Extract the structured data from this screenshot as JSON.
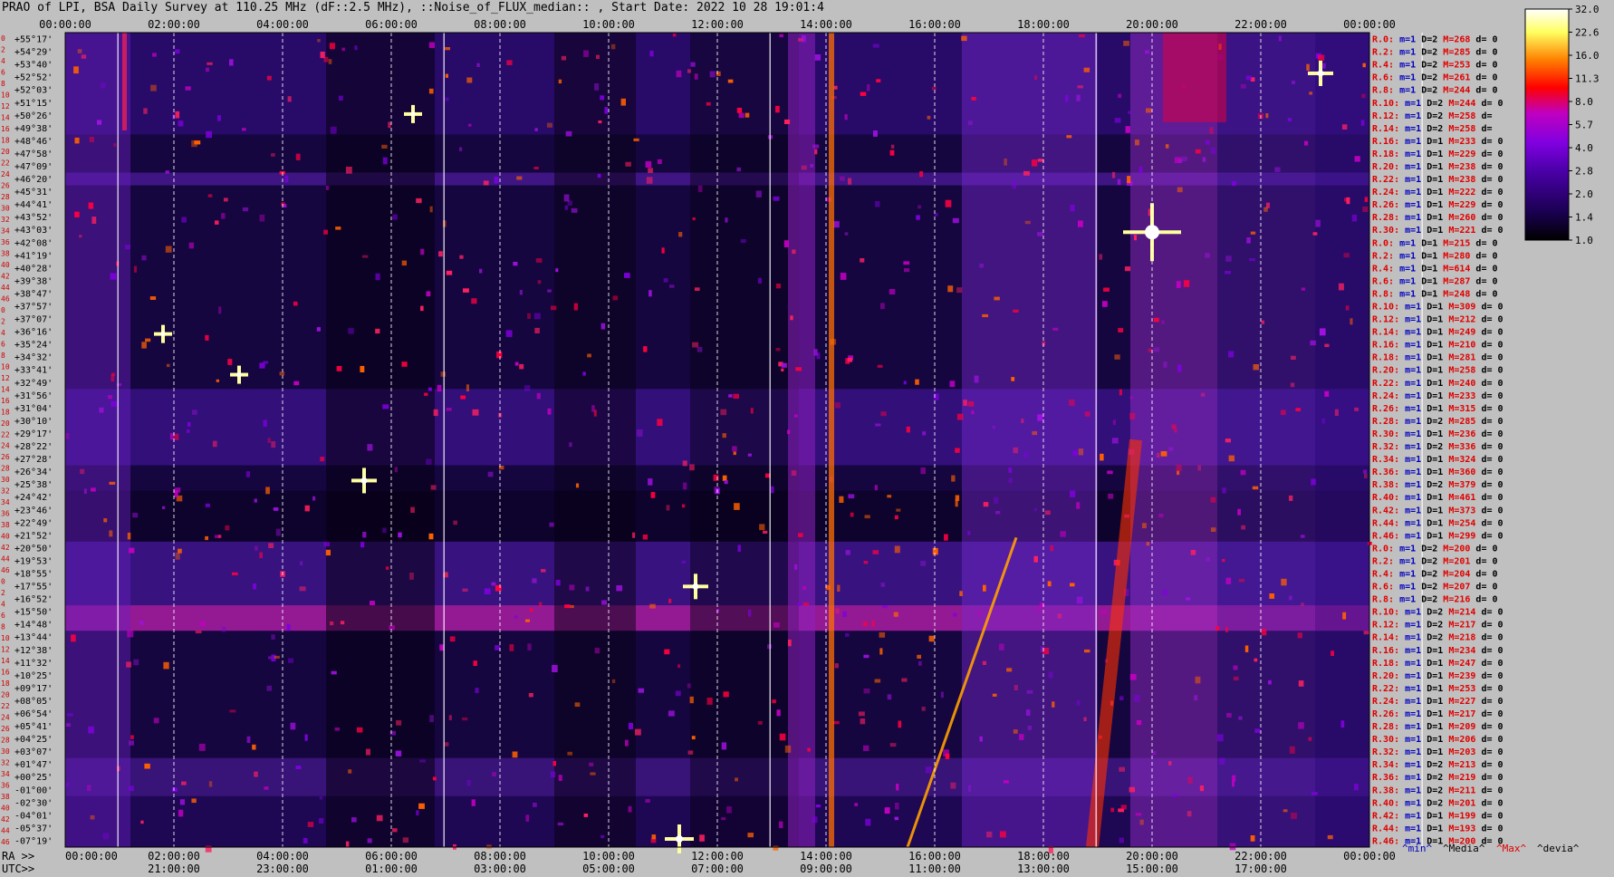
{
  "header": {
    "title": "PRAO of LPI, BSA Daily Survey at 110.25 MHz (dF::2.5 MHz), ::Noise_of_FLUX_median:: , Start Date: 2022 10 28 19:01:4"
  },
  "axes": {
    "ra_prefix": "RA >>",
    "utc_prefix": "UTC>>"
  },
  "chart_data": {
    "type": "heatmap",
    "title": "PRAO of LPI, BSA Daily Survey at 110.25 MHz (dF::2.5 MHz), ::Noise_of_FLUX_median:: , Start Date: 2022 10 28 19:01:4",
    "x_top_ticks": [
      "00:00:00",
      "02:00:00",
      "04:00:00",
      "06:00:00",
      "08:00:00",
      "10:00:00",
      "12:00:00",
      "14:00:00",
      "16:00:00",
      "18:00:00",
      "20:00:00",
      "22:00:00",
      "00:00:00"
    ],
    "x_ra_ticks": [
      "00:00:00",
      "02:00:00",
      "04:00:00",
      "06:00:00",
      "08:00:00",
      "10:00:00",
      "12:00:00",
      "14:00:00",
      "16:00:00",
      "18:00:00",
      "20:00:00",
      "22:00:00",
      "00:00:00"
    ],
    "x_utc_ticks": [
      "21:00:00",
      "23:00:00",
      "01:00:00",
      "03:00:00",
      "05:00:00",
      "07:00:00",
      "09:00:00",
      "11:00:00",
      "13:00:00",
      "15:00:00",
      "17:00:00"
    ],
    "declinations": [
      "+55°17'",
      "+54°29'",
      "+53°40'",
      "+52°52'",
      "+52°03'",
      "+51°15'",
      "+50°26'",
      "+49°38'",
      "+48°46'",
      "+47°58'",
      "+47°09'",
      "+46°20'",
      "+45°31'",
      "+44°41'",
      "+43°52'",
      "+43°03'",
      "+42°08'",
      "+41°19'",
      "+40°28'",
      "+39°38'",
      "+38°47'",
      "+37°57'",
      "+37°07'",
      "+36°16'",
      "+35°24'",
      "+34°32'",
      "+33°41'",
      "+32°49'",
      "+31°56'",
      "+31°04'",
      "+30°10'",
      "+29°17'",
      "+28°22'",
      "+27°28'",
      "+26°34'",
      "+25°38'",
      "+24°42'",
      "+23°46'",
      "+22°49'",
      "+21°52'",
      "+20°50'",
      "+19°53'",
      "+18°55'",
      "+17°55'",
      "+16°52'",
      "+15°50'",
      "+14°48'",
      "+13°44'",
      "+12°38'",
      "+11°32'",
      "+10°25'",
      "+09°17'",
      "+08°05'",
      "+06°54'",
      "+05°41'",
      "+04°25'",
      "+03°07'",
      "+01°47'",
      "+00°25'",
      "-01°00'",
      "-02°30'",
      "-04°01'",
      "-05°37'",
      "-07°19'"
    ],
    "row_index": [
      "0",
      "2",
      "4",
      "6",
      "8",
      "10",
      "12",
      "14",
      "16",
      "18",
      "20",
      "22",
      "24",
      "26",
      "28",
      "30",
      "32",
      "34",
      "36",
      "38",
      "40",
      "42",
      "44",
      "46",
      "0",
      "2",
      "4",
      "6",
      "8",
      "10",
      "12",
      "14",
      "16",
      "18",
      "20",
      "22",
      "24",
      "26",
      "28",
      "30",
      "32",
      "34",
      "36",
      "38",
      "40",
      "42",
      "44",
      "46",
      "0",
      "2",
      "4",
      "6",
      "8",
      "10",
      "12",
      "14",
      "16",
      "18",
      "20",
      "22",
      "24",
      "26",
      "28",
      "30",
      "32",
      "34",
      "36",
      "38",
      "40",
      "42",
      "44",
      "46"
    ],
    "colorbar": {
      "ticks": [
        "32.0",
        "22.6",
        "16.0",
        "11.3",
        "8.0",
        "5.7",
        "4.0",
        "2.8",
        "2.0",
        "1.4",
        "1.0"
      ],
      "scale": "log",
      "colors": [
        "#000000",
        "#1a0050",
        "#4a00a8",
        "#8000e0",
        "#c000c0",
        "#ff0000",
        "#ff8000",
        "#ffff60",
        "#ffffff"
      ]
    },
    "receivers": [
      {
        "r": "R.0:",
        "m": "m=1",
        "d": "D=2",
        "max": "M=268",
        "dev": "d= 0"
      },
      {
        "r": "R.2:",
        "m": "m=1",
        "d": "D=2",
        "max": "M=285",
        "dev": "d= 0"
      },
      {
        "r": "R.4:",
        "m": "m=1",
        "d": "D=2",
        "max": "M=253",
        "dev": "d= 0"
      },
      {
        "r": "R.6:",
        "m": "m=1",
        "d": "D=2",
        "max": "M=261",
        "dev": "d= 0"
      },
      {
        "r": "R.8:",
        "m": "m=1",
        "d": "D=2",
        "max": "M=244",
        "dev": "d= 0"
      },
      {
        "r": "R.10:",
        "m": "m=1",
        "d": "D=2",
        "max": "M=244",
        "dev": "d= 0"
      },
      {
        "r": "R.12:",
        "m": "m=1",
        "d": "D=2",
        "max": "M=258",
        "dev": "d="
      },
      {
        "r": "R.14:",
        "m": "m=1",
        "d": "D=2",
        "max": "M=258",
        "dev": "d="
      },
      {
        "r": "R.16:",
        "m": "m=1",
        "d": "D=1",
        "max": "M=233",
        "dev": "d= 0"
      },
      {
        "r": "R.18:",
        "m": "m=1",
        "d": "D=1",
        "max": "M=229",
        "dev": "d= 0"
      },
      {
        "r": "R.20:",
        "m": "m=1",
        "d": "D=1",
        "max": "M=238",
        "dev": "d= 0"
      },
      {
        "r": "R.22:",
        "m": "m=1",
        "d": "D=1",
        "max": "M=238",
        "dev": "d= 0"
      },
      {
        "r": "R.24:",
        "m": "m=1",
        "d": "D=1",
        "max": "M=222",
        "dev": "d= 0"
      },
      {
        "r": "R.26:",
        "m": "m=1",
        "d": "D=1",
        "max": "M=229",
        "dev": "d= 0"
      },
      {
        "r": "R.28:",
        "m": "m=1",
        "d": "D=1",
        "max": "M=260",
        "dev": "d= 0"
      },
      {
        "r": "R.30:",
        "m": "m=1",
        "d": "D=1",
        "max": "M=221",
        "dev": "d= 0"
      },
      {
        "r": "R.0:",
        "m": "m=1",
        "d": "D=1",
        "max": "M=215",
        "dev": "d= 0"
      },
      {
        "r": "R.2:",
        "m": "m=1",
        "d": "D=1",
        "max": "M=280",
        "dev": "d= 0"
      },
      {
        "r": "R.4:",
        "m": "m=1",
        "d": "D=1",
        "max": "M=614",
        "dev": "d= 0"
      },
      {
        "r": "R.6:",
        "m": "m=1",
        "d": "D=1",
        "max": "M=287",
        "dev": "d= 0"
      },
      {
        "r": "R.8:",
        "m": "m=1",
        "d": "D=1",
        "max": "M=248",
        "dev": "d= 0"
      },
      {
        "r": "R.10:",
        "m": "m=1",
        "d": "D=1",
        "max": "M=309",
        "dev": "d= 0"
      },
      {
        "r": "R.12:",
        "m": "m=1",
        "d": "D=1",
        "max": "M=212",
        "dev": "d= 0"
      },
      {
        "r": "R.14:",
        "m": "m=1",
        "d": "D=1",
        "max": "M=249",
        "dev": "d= 0"
      },
      {
        "r": "R.16:",
        "m": "m=1",
        "d": "D=1",
        "max": "M=210",
        "dev": "d= 0"
      },
      {
        "r": "R.18:",
        "m": "m=1",
        "d": "D=1",
        "max": "M=281",
        "dev": "d= 0"
      },
      {
        "r": "R.20:",
        "m": "m=1",
        "d": "D=1",
        "max": "M=258",
        "dev": "d= 0"
      },
      {
        "r": "R.22:",
        "m": "m=1",
        "d": "D=1",
        "max": "M=240",
        "dev": "d= 0"
      },
      {
        "r": "R.24:",
        "m": "m=1",
        "d": "D=1",
        "max": "M=233",
        "dev": "d= 0"
      },
      {
        "r": "R.26:",
        "m": "m=1",
        "d": "D=1",
        "max": "M=315",
        "dev": "d= 0"
      },
      {
        "r": "R.28:",
        "m": "m=1",
        "d": "D=2",
        "max": "M=285",
        "dev": "d= 0"
      },
      {
        "r": "R.30:",
        "m": "m=1",
        "d": "D=1",
        "max": "M=236",
        "dev": "d= 0"
      },
      {
        "r": "R.32:",
        "m": "m=1",
        "d": "D=2",
        "max": "M=336",
        "dev": "d= 0"
      },
      {
        "r": "R.34:",
        "m": "m=1",
        "d": "D=1",
        "max": "M=324",
        "dev": "d= 0"
      },
      {
        "r": "R.36:",
        "m": "m=1",
        "d": "D=1",
        "max": "M=360",
        "dev": "d= 0"
      },
      {
        "r": "R.38:",
        "m": "m=1",
        "d": "D=2",
        "max": "M=379",
        "dev": "d= 0"
      },
      {
        "r": "R.40:",
        "m": "m=1",
        "d": "D=1",
        "max": "M=461",
        "dev": "d= 0"
      },
      {
        "r": "R.42:",
        "m": "m=1",
        "d": "D=1",
        "max": "M=373",
        "dev": "d= 0"
      },
      {
        "r": "R.44:",
        "m": "m=1",
        "d": "D=1",
        "max": "M=254",
        "dev": "d= 0"
      },
      {
        "r": "R.46:",
        "m": "m=1",
        "d": "D=1",
        "max": "M=299",
        "dev": "d= 0"
      },
      {
        "r": "R.0:",
        "m": "m=1",
        "d": "D=2",
        "max": "M=200",
        "dev": "d= 0"
      },
      {
        "r": "R.2:",
        "m": "m=1",
        "d": "D=2",
        "max": "M=201",
        "dev": "d= 0"
      },
      {
        "r": "R.4:",
        "m": "m=1",
        "d": "D=2",
        "max": "M=204",
        "dev": "d= 0"
      },
      {
        "r": "R.6:",
        "m": "m=1",
        "d": "D=2",
        "max": "M=207",
        "dev": "d= 0"
      },
      {
        "r": "R.8:",
        "m": "m=1",
        "d": "D=2",
        "max": "M=216",
        "dev": "d= 0"
      },
      {
        "r": "R.10:",
        "m": "m=1",
        "d": "D=2",
        "max": "M=214",
        "dev": "d= 0"
      },
      {
        "r": "R.12:",
        "m": "m=1",
        "d": "D=2",
        "max": "M=217",
        "dev": "d= 0"
      },
      {
        "r": "R.14:",
        "m": "m=1",
        "d": "D=2",
        "max": "M=218",
        "dev": "d= 0"
      },
      {
        "r": "R.16:",
        "m": "m=1",
        "d": "D=1",
        "max": "M=234",
        "dev": "d= 0"
      },
      {
        "r": "R.18:",
        "m": "m=1",
        "d": "D=1",
        "max": "M=247",
        "dev": "d= 0"
      },
      {
        "r": "R.20:",
        "m": "m=1",
        "d": "D=1",
        "max": "M=239",
        "dev": "d= 0"
      },
      {
        "r": "R.22:",
        "m": "m=1",
        "d": "D=1",
        "max": "M=253",
        "dev": "d= 0"
      },
      {
        "r": "R.24:",
        "m": "m=1",
        "d": "D=1",
        "max": "M=227",
        "dev": "d= 0"
      },
      {
        "r": "R.26:",
        "m": "m=1",
        "d": "D=1",
        "max": "M=217",
        "dev": "d= 0"
      },
      {
        "r": "R.28:",
        "m": "m=1",
        "d": "D=1",
        "max": "M=209",
        "dev": "d= 0"
      },
      {
        "r": "R.30:",
        "m": "m=1",
        "d": "D=1",
        "max": "M=206",
        "dev": "d= 0"
      },
      {
        "r": "R.32:",
        "m": "m=1",
        "d": "D=1",
        "max": "M=203",
        "dev": "d= 0"
      },
      {
        "r": "R.34:",
        "m": "m=1",
        "d": "D=2",
        "max": "M=213",
        "dev": "d= 0"
      },
      {
        "r": "R.36:",
        "m": "m=1",
        "d": "D=2",
        "max": "M=219",
        "dev": "d= 0"
      },
      {
        "r": "R.38:",
        "m": "m=1",
        "d": "D=2",
        "max": "M=211",
        "dev": "d= 0"
      },
      {
        "r": "R.40:",
        "m": "m=1",
        "d": "D=2",
        "max": "M=201",
        "dev": "d= 0"
      },
      {
        "r": "R.42:",
        "m": "m=1",
        "d": "D=1",
        "max": "M=199",
        "dev": "d= 0"
      },
      {
        "r": "R.44:",
        "m": "m=1",
        "d": "D=1",
        "max": "M=193",
        "dev": "d= 0"
      },
      {
        "r": "R.46:",
        "m": "m=1",
        "d": "D=1",
        "max": "M=200",
        "dev": "d= 0"
      }
    ],
    "legend": [
      {
        "label": "^min^",
        "color": "#0000c0"
      },
      {
        "label": "^Media^",
        "color": "#000000"
      },
      {
        "label": "^Max^",
        "color": "#e00000"
      },
      {
        "label": "^devia^",
        "color": "#000000"
      }
    ]
  }
}
